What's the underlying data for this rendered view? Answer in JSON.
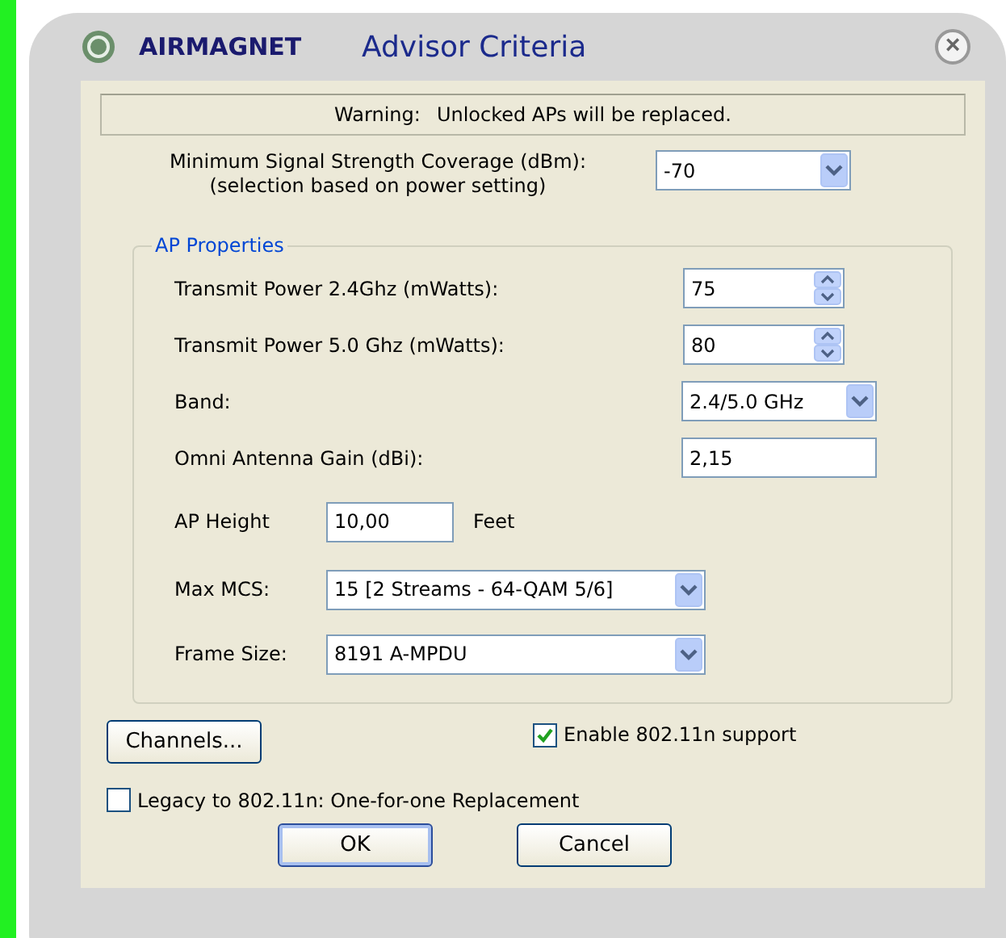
{
  "window": {
    "brand": "AIRMAGNET",
    "title": "Advisor Criteria",
    "close": "×"
  },
  "warning": {
    "label": "Warning:",
    "text": "Unlocked APs will be replaced."
  },
  "signal": {
    "label": "Minimum Signal Strength Coverage (dBm):",
    "sublabel": "(selection based on power setting)",
    "value": "-70"
  },
  "ap_properties": {
    "legend": "AP Properties",
    "rows": [
      {
        "kind": "spin",
        "label": "Transmit Power 2.4Ghz (mWatts):",
        "value": "75"
      },
      {
        "kind": "spin",
        "label": "Transmit Power 5.0 Ghz (mWatts):",
        "value": "80"
      },
      {
        "kind": "combo",
        "label": "Band:",
        "value": "2.4/5.0 GHz"
      },
      {
        "kind": "text",
        "label": "Omni Antenna Gain (dBi):",
        "value": "2,15"
      }
    ],
    "height": {
      "label": "AP Height",
      "value": "10,00",
      "unit": "Feet"
    },
    "narrow_rows": [
      {
        "label": "Max MCS:",
        "value": "15 [2 Streams - 64-QAM 5/6]"
      },
      {
        "label": "Frame Size:",
        "value": "8191  A-MPDU"
      }
    ]
  },
  "channels_button": "Channels...",
  "enable_n": {
    "label": "Enable 802.11n support",
    "checked": true
  },
  "legacy": {
    "label": "Legacy to 802.11n: One-for-one Replacement",
    "checked": false
  },
  "buttons": [
    {
      "label": "OK",
      "default": true
    },
    {
      "label": "Cancel",
      "default": false
    }
  ]
}
